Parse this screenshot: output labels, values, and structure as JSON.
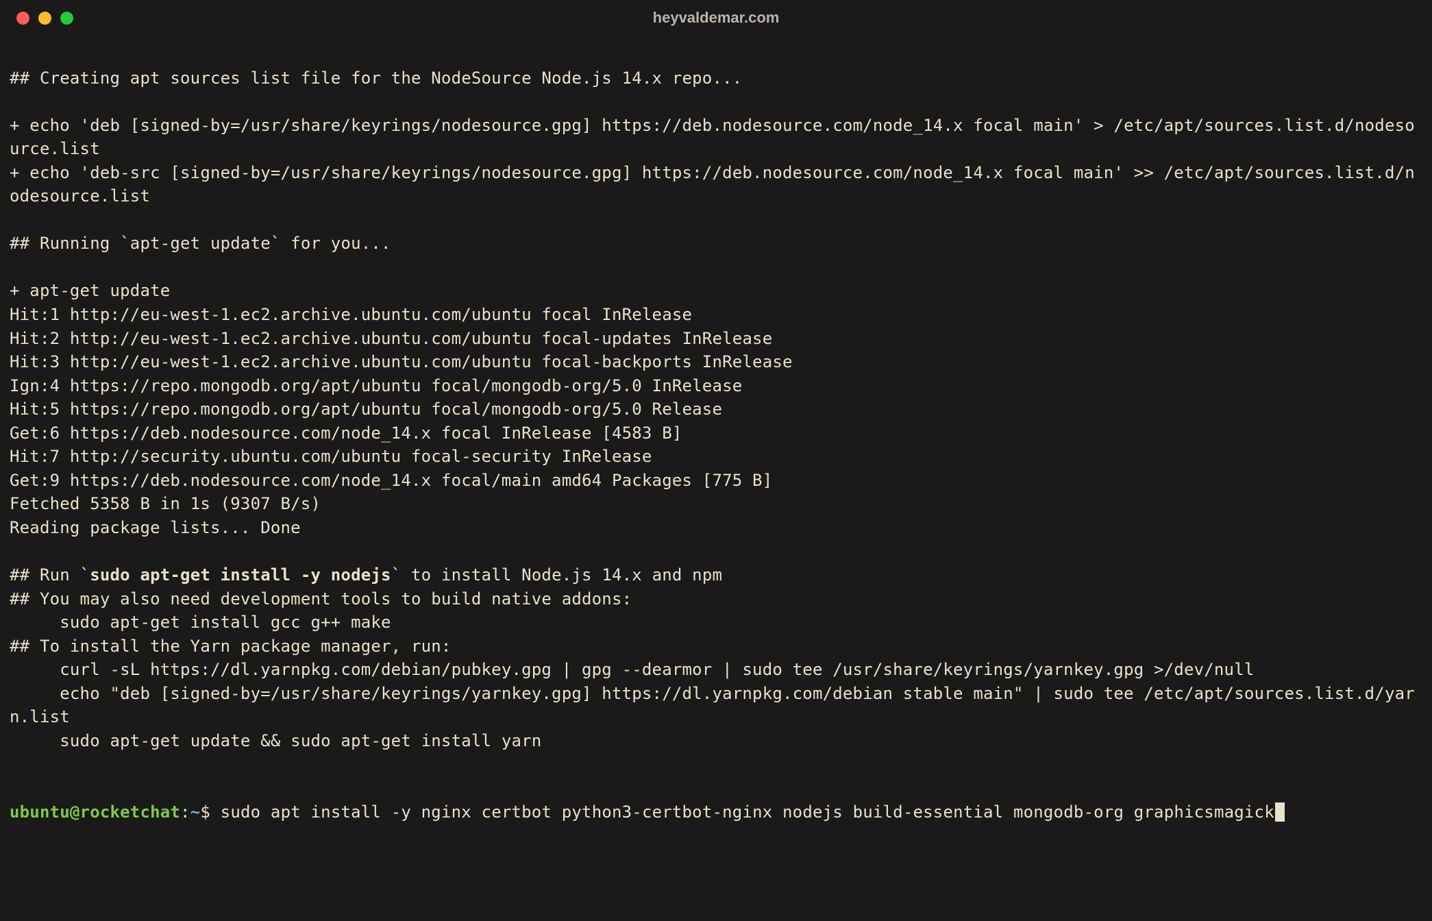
{
  "window": {
    "title": "heyvaldemar.com"
  },
  "terminal": {
    "lines": [
      "",
      "## Creating apt sources list file for the NodeSource Node.js 14.x repo...",
      "",
      "+ echo 'deb [signed-by=/usr/share/keyrings/nodesource.gpg] https://deb.nodesource.com/node_14.x focal main' > /etc/apt/sources.list.d/nodesource.list",
      "+ echo 'deb-src [signed-by=/usr/share/keyrings/nodesource.gpg] https://deb.nodesource.com/node_14.x focal main' >> /etc/apt/sources.list.d/nodesource.list",
      "",
      "## Running `apt-get update` for you...",
      "",
      "+ apt-get update",
      "Hit:1 http://eu-west-1.ec2.archive.ubuntu.com/ubuntu focal InRelease",
      "Hit:2 http://eu-west-1.ec2.archive.ubuntu.com/ubuntu focal-updates InRelease",
      "Hit:3 http://eu-west-1.ec2.archive.ubuntu.com/ubuntu focal-backports InRelease",
      "Ign:4 https://repo.mongodb.org/apt/ubuntu focal/mongodb-org/5.0 InRelease",
      "Hit:5 https://repo.mongodb.org/apt/ubuntu focal/mongodb-org/5.0 Release",
      "Get:6 https://deb.nodesource.com/node_14.x focal InRelease [4583 B]",
      "Hit:7 http://security.ubuntu.com/ubuntu focal-security InRelease",
      "Get:9 https://deb.nodesource.com/node_14.x focal/main amd64 Packages [775 B]",
      "Fetched 5358 B in 1s (9307 B/s)",
      "Reading package lists... Done",
      ""
    ],
    "run_line_prefix": "## Run `",
    "run_line_bold": "sudo apt-get install -y nodejs",
    "run_line_suffix": "` to install Node.js 14.x and npm",
    "post_run_lines": [
      "## You may also need development tools to build native addons:",
      "     sudo apt-get install gcc g++ make",
      "## To install the Yarn package manager, run:",
      "     curl -sL https://dl.yarnpkg.com/debian/pubkey.gpg | gpg --dearmor | sudo tee /usr/share/keyrings/yarnkey.gpg >/dev/null",
      "     echo \"deb [signed-by=/usr/share/keyrings/yarnkey.gpg] https://dl.yarnpkg.com/debian stable main\" | sudo tee /etc/apt/sources.list.d/yarn.list",
      "     sudo apt-get update && sudo apt-get install yarn",
      "",
      ""
    ],
    "prompt": {
      "user_host": "ubuntu@rocketchat",
      "colon": ":",
      "path": "~",
      "dollar": "$ ",
      "command": "sudo apt install -y nginx certbot python3-certbot-nginx nodejs build-essential mongodb-org graphicsmagick"
    }
  }
}
